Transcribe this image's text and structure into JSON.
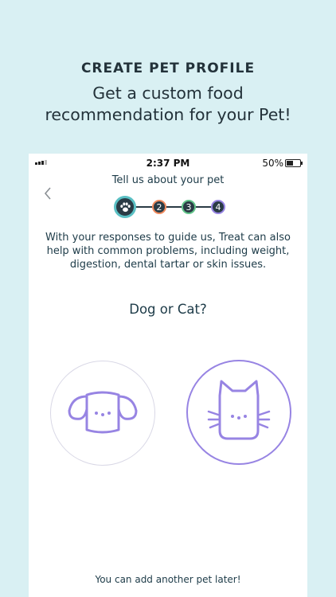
{
  "promo": {
    "title": "CREATE PET PROFILE",
    "subtitle_line1": "Get a custom food",
    "subtitle_line2": "recommendation for your Pet!"
  },
  "status_bar": {
    "time": "2:37 PM",
    "battery": "50%",
    "battery_level": 0.5
  },
  "header": {
    "title": "Tell us about your pet",
    "back_icon": "chevron-left-icon"
  },
  "stepper": {
    "current_icon": "paw-icon",
    "steps": [
      "2",
      "3",
      "4"
    ],
    "colors": {
      "current_ring": "#5bc0c4",
      "step2_ring": "#f08a5d",
      "step3_ring": "#62c58a",
      "step4_ring": "#9784e3",
      "fill": "#2a3b45"
    }
  },
  "intro_text": "With your responses to guide us, Treat can also help with common problems, including weight, digestion, dental tartar or skin issues.",
  "question": "Dog or Cat?",
  "options": [
    {
      "icon": "dog-icon",
      "selected": false
    },
    {
      "icon": "cat-icon",
      "selected": true
    }
  ],
  "accent_color": "#9784e3",
  "footer_note": "You can add another pet later!"
}
